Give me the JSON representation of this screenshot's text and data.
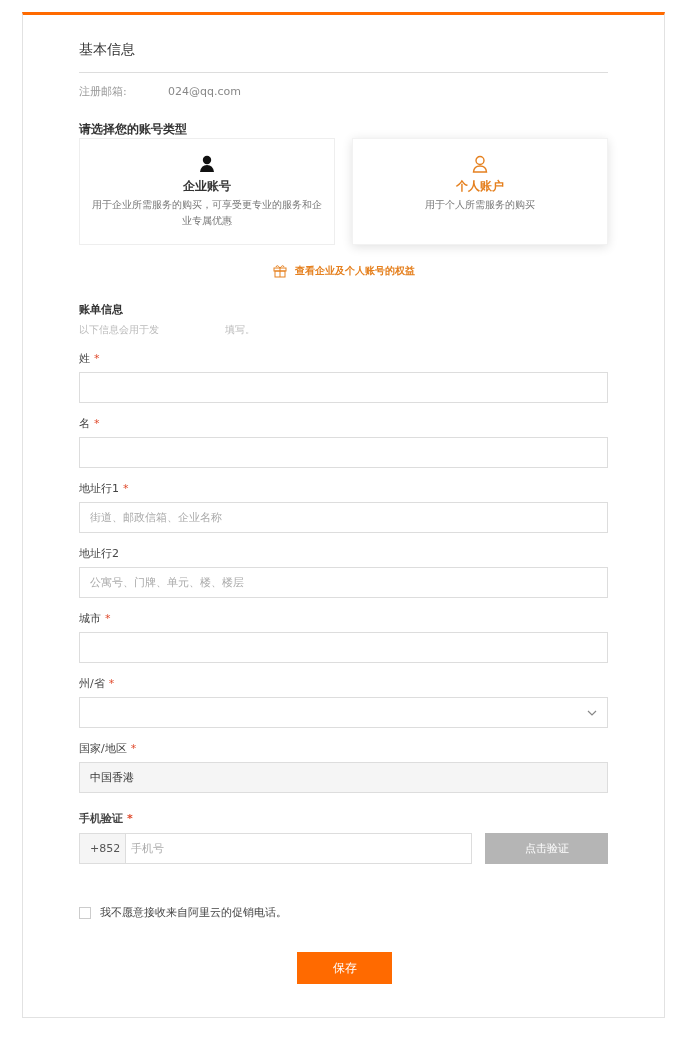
{
  "section_title": "基本信息",
  "email": {
    "label": "注册邮箱:",
    "value": "024@qq.com"
  },
  "account_type": {
    "heading": "请选择您的账号类型",
    "options": [
      {
        "kind": "enterprise",
        "title": "企业账号",
        "description": "用于企业所需服务的购买，可享受更专业的服务和企业专属优惠",
        "selected": false
      },
      {
        "kind": "personal",
        "title": "个人账户",
        "description": "用于个人所需服务的购买",
        "selected": true
      }
    ],
    "benefits_link": "查看企业及个人账号的权益"
  },
  "billing": {
    "heading": "账单信息",
    "subtitle_visible_start": "以下信息会用于发",
    "subtitle_visible_end": "填写。"
  },
  "fields": [
    {
      "kind": "text",
      "label": "姓",
      "required_mark": "*"
    },
    {
      "kind": "text",
      "label": "名",
      "required_mark": "*"
    },
    {
      "kind": "text",
      "label": "地址行1",
      "required_mark": "*",
      "placeholder": "街道、邮政信箱、企业名称"
    },
    {
      "kind": "text",
      "label": "地址行2",
      "placeholder": "公寓号、门牌、单元、楼、楼层"
    },
    {
      "kind": "text",
      "label": "城市",
      "required_mark": "*"
    },
    {
      "kind": "select",
      "label": "州/省",
      "required_mark": "*"
    },
    {
      "kind": "readonly",
      "label": "国家/地区",
      "required_mark": "*",
      "value": "中国香港"
    }
  ],
  "phone": {
    "label": "手机验证",
    "required_mark": "*",
    "prefix": "+852",
    "placeholder": "手机号",
    "verify_button": "点击验证",
    "verify_disabled": true
  },
  "opt_out": {
    "label": "我不愿意接收来自阿里云的促销电话。",
    "checked": false
  },
  "save_button": "保存"
}
